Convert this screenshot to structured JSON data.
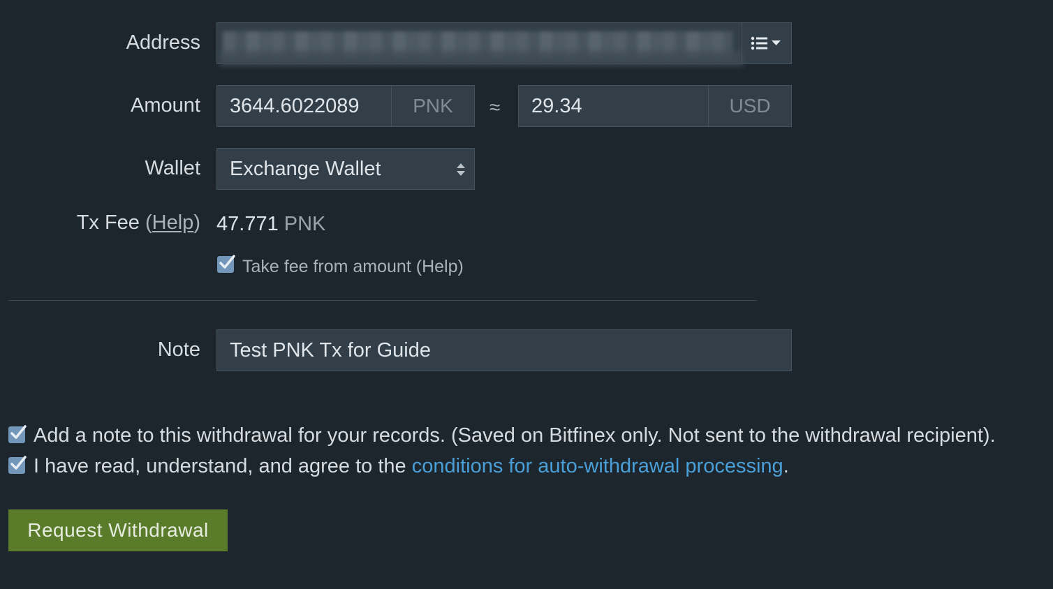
{
  "form": {
    "address": {
      "label": "Address",
      "addon_icon": "list-dropdown-icon"
    },
    "amount": {
      "label": "Amount",
      "value": "3644.6022089",
      "currency": "PNK",
      "approx_symbol": "≈",
      "usd_value": "29.34",
      "usd_currency": "USD"
    },
    "wallet": {
      "label": "Wallet",
      "selected": "Exchange Wallet"
    },
    "tx_fee": {
      "label": "Tx Fee",
      "open_paren": "(",
      "help_text": "Help",
      "close_paren": ")",
      "value": "47.771",
      "unit": "PNK"
    },
    "take_fee": {
      "checked": true,
      "label": "Take fee from amount",
      "open_paren": "(",
      "help_text": "Help",
      "close_paren": ")"
    },
    "note": {
      "label": "Note",
      "value": "Test PNK Tx for Guide"
    },
    "add_note_checkbox": {
      "checked": true,
      "label": "Add a note to this withdrawal for your records. (Saved on Bitfinex only. Not sent to the withdrawal recipient)."
    },
    "agree_checkbox": {
      "checked": true,
      "label_prefix": "I have read, understand, and agree to the ",
      "link_text": "conditions for auto-withdrawal processing",
      "label_suffix": "."
    },
    "submit_label": "Request Withdrawal"
  },
  "colors": {
    "background": "#1d262d",
    "input_bg": "#323f49",
    "link": "#4a9fd9",
    "checkbox": "#7397bb",
    "primary_button": "#5a7b2a"
  }
}
